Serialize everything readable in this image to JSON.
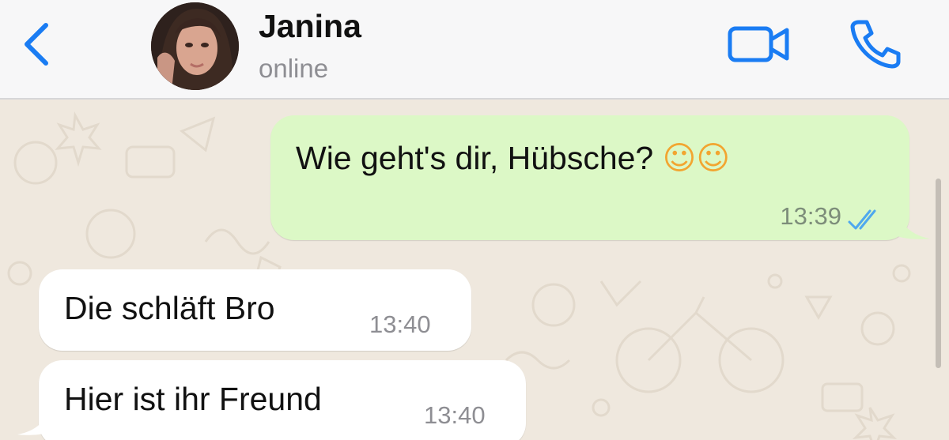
{
  "header": {
    "back_icon": "chevron-left-icon",
    "contact_name": "Janina",
    "contact_status": "online",
    "video_icon": "video-camera-icon",
    "call_icon": "phone-icon"
  },
  "messages": [
    {
      "direction": "outgoing",
      "text": "Wie geht's dir, Hübsche?",
      "emoji": "☺☺",
      "time": "13:39",
      "status_icon": "double-check-icon"
    },
    {
      "direction": "incoming",
      "text": "Die schläft Bro",
      "time": "13:40"
    },
    {
      "direction": "incoming",
      "text": "Hier ist ihr Freund",
      "time": "13:40"
    }
  ],
  "colors": {
    "accent": "#1a7cf3",
    "outgoing_bubble": "#dcf8c6",
    "incoming_bubble": "#ffffff",
    "wallpaper": "#efe8de",
    "read_ticks": "#4fa8ee"
  }
}
